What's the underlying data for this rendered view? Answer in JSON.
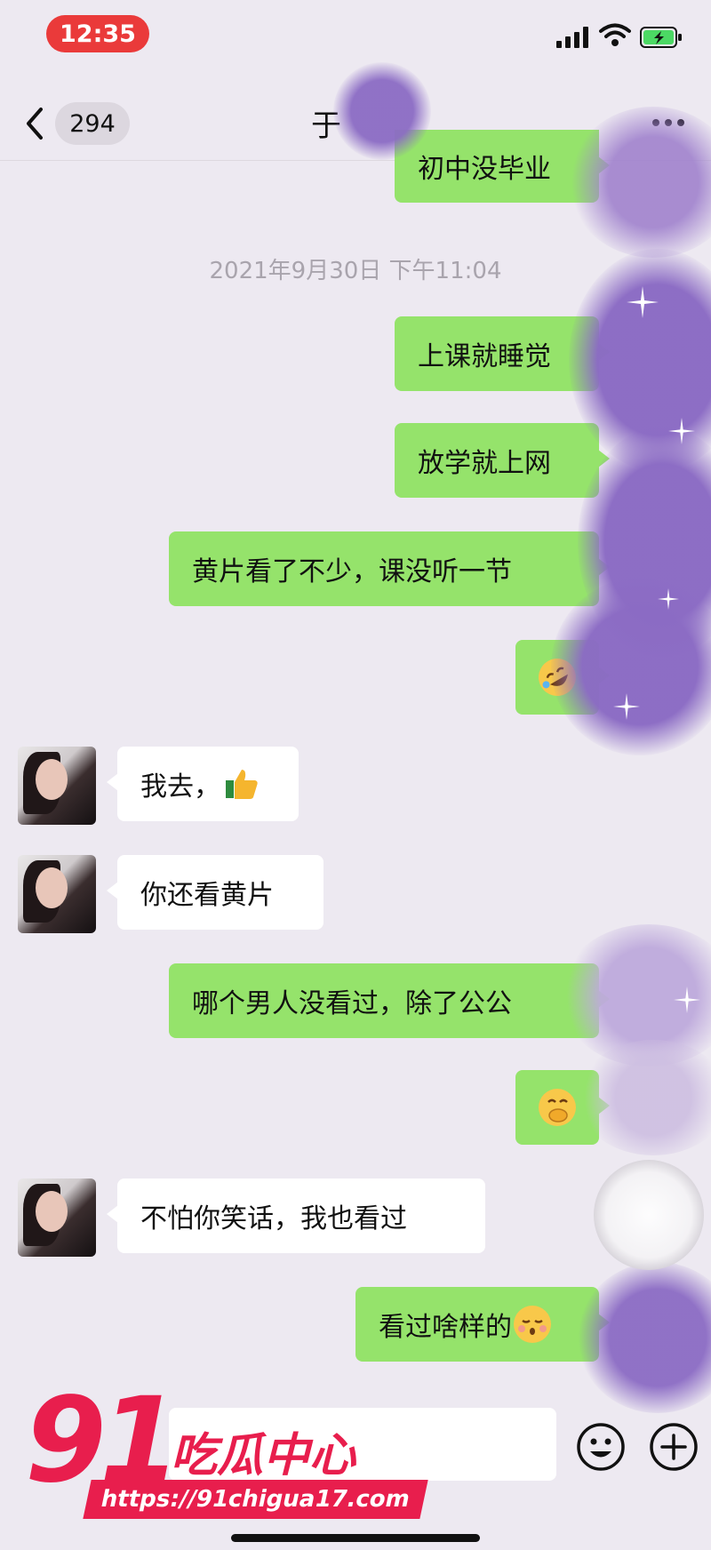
{
  "status_bar": {
    "time": "12:35"
  },
  "nav": {
    "back_count": "294",
    "title": "于"
  },
  "timestamp": "2021年9月30日 下午11:04",
  "messages": [
    {
      "text": "初中没毕业"
    },
    {
      "text": "上课就睡觉"
    },
    {
      "text": "放学就上网"
    },
    {
      "text": "黄片看了不少，课没听一节"
    },
    {
      "text": "",
      "emoji": "rolling-on-floor-laughing"
    },
    {
      "text": "我去，",
      "emoji": "thumbs-up"
    },
    {
      "text": "你还看黄片"
    },
    {
      "text": "哪个男人没看过，除了公公"
    },
    {
      "text": "",
      "emoji": "hand-over-mouth"
    },
    {
      "text": "不怕你笑话，我也看过"
    },
    {
      "text": "看过啥样的",
      "emoji": "kissing-closed-eyes"
    }
  ],
  "watermark": {
    "number": "91",
    "name": "吃瓜中心",
    "url": "https://91chigua17.com"
  },
  "colors": {
    "sent_bubble": "#95e36b",
    "received_bubble": "#ffffff",
    "background": "#ede9f1",
    "time_pill": "#ea3a3a",
    "watermark": "#e81e4d",
    "redaction": "#8b6bc4"
  }
}
